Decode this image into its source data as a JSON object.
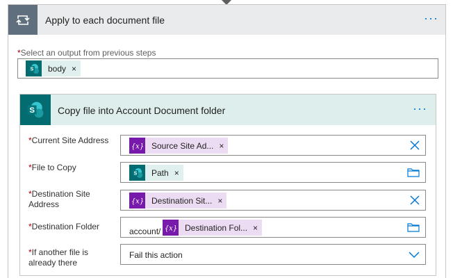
{
  "loop": {
    "title": "Apply to each document file",
    "more_label": "···",
    "select_label": "Select an output from previous steps",
    "required_mark": "*",
    "tokens": [
      {
        "label": "body",
        "remove": "×"
      }
    ]
  },
  "action": {
    "title": "Copy file into Account Document folder",
    "more_label": "···",
    "fields": [
      {
        "label": "Current Site Address",
        "token": "Source Site Ad...",
        "remove": "×"
      },
      {
        "label": "File to Copy",
        "token": "Path",
        "remove": "×"
      },
      {
        "label": "Destination Site Address",
        "token": "Destination Sit...",
        "remove": "×"
      },
      {
        "label": "Destination Folder",
        "prefix": "account/",
        "token": "Destination Fol...",
        "remove": "×"
      },
      {
        "label": "If another file is already there",
        "value": "Fail this action"
      }
    ]
  },
  "colors": {
    "accent": "#0078d4",
    "sharepoint": "#036c70",
    "variable": "#7719aa",
    "loop_tile": "#5f6f7d",
    "required": "#a80000"
  },
  "icons": {
    "loop": "loop-icon",
    "sharepoint": "sharepoint-icon",
    "variable": "variable-icon",
    "clear": "clear-icon",
    "folder": "folder-icon",
    "chevron": "chevron-down-icon"
  }
}
